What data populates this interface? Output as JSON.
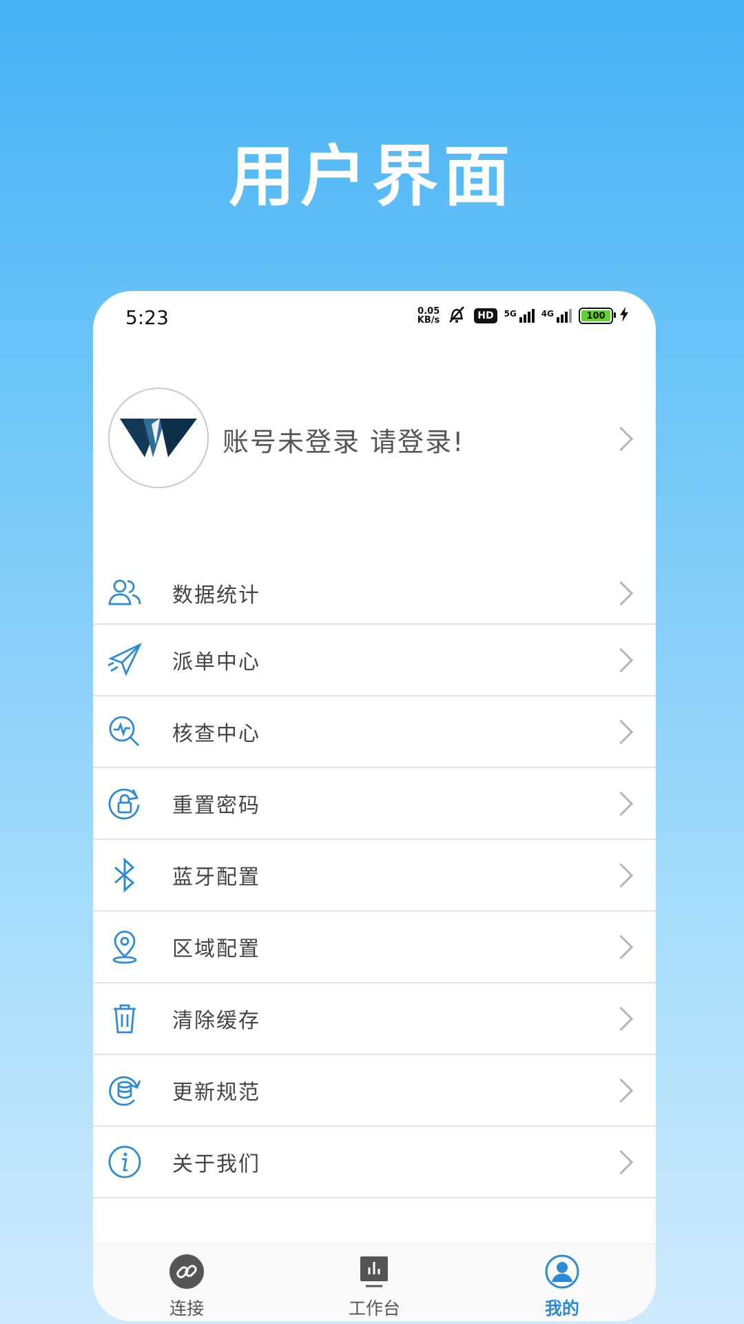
{
  "banner": {
    "title": "用户界面"
  },
  "status_bar": {
    "time": "5:23",
    "net_speed_value": "0.05",
    "net_speed_unit": "KB/s",
    "hd_label": "HD",
    "signal1_label": "5G",
    "signal2_label": "4G",
    "battery": "100"
  },
  "profile": {
    "login_text": "账号未登录  请登录!"
  },
  "menu": {
    "items": [
      {
        "label": "数据统计",
        "icon": "users-icon"
      },
      {
        "label": "派单中心",
        "icon": "paper-plane-icon"
      },
      {
        "label": "核查中心",
        "icon": "search-pulse-icon"
      },
      {
        "label": "重置密码",
        "icon": "lock-reset-icon"
      },
      {
        "label": "蓝牙配置",
        "icon": "bluetooth-icon"
      },
      {
        "label": "区域配置",
        "icon": "location-pin-icon"
      },
      {
        "label": "清除缓存",
        "icon": "trash-icon"
      },
      {
        "label": "更新规范",
        "icon": "database-refresh-icon"
      },
      {
        "label": "关于我们",
        "icon": "info-icon"
      }
    ]
  },
  "tabbar": {
    "tabs": [
      {
        "label": "连接",
        "icon": "link-icon",
        "active": false
      },
      {
        "label": "工作台",
        "icon": "chart-icon",
        "active": false
      },
      {
        "label": "我的",
        "icon": "user-icon",
        "active": true
      }
    ]
  },
  "colors": {
    "accent": "#2d8bd6",
    "banner_top": "#46b2f3",
    "banner_bottom": "#cfeafc"
  }
}
